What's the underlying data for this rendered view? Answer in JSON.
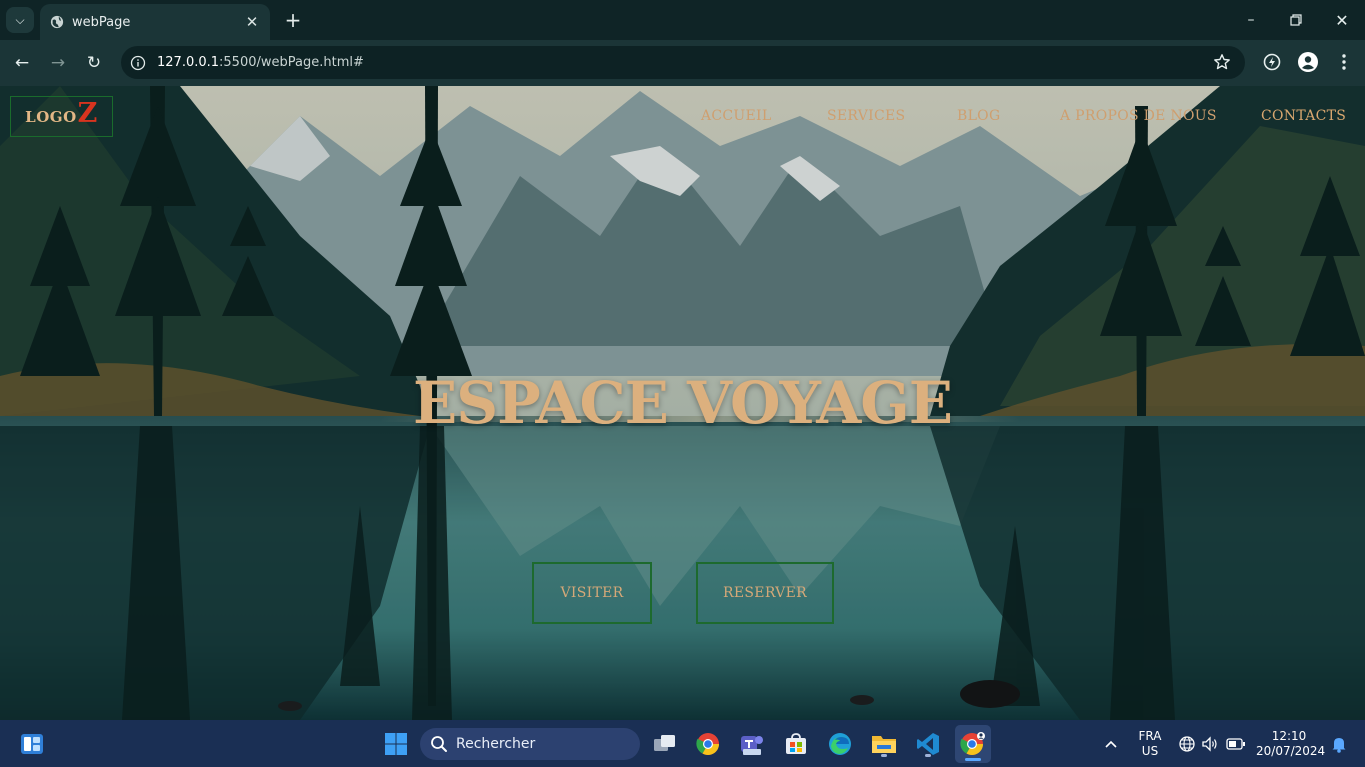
{
  "browser": {
    "tab_title": "webPage",
    "url_host": "127.0.0.1",
    "url_path": ":5500/webPage.html#"
  },
  "site": {
    "logo_text": "LOGO",
    "logo_letter": "Z",
    "nav": [
      "ACCUEIL",
      "SERVICES",
      "BLOG",
      "A PROPOS DE NOUS",
      "CONTACTS"
    ],
    "hero_title": "ESPACE VOYAGE",
    "buttons": {
      "visit": "VISITER",
      "book": "RESERVER"
    }
  },
  "taskbar": {
    "search_placeholder": "Rechercher",
    "lang_primary": "FRA",
    "lang_secondary": "US",
    "time": "12:10",
    "date": "20/07/2024"
  },
  "colors": {
    "nav_text": "#cf9f6f",
    "hero_title": "#dcb07e",
    "logo_z": "#d8341f",
    "button_border": "#1d6a2e"
  }
}
